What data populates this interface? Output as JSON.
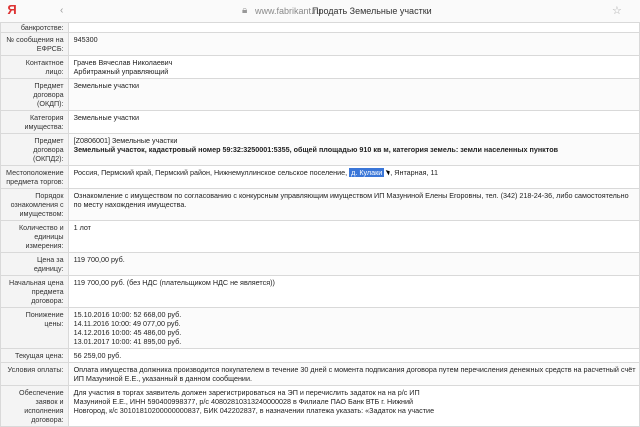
{
  "browser": {
    "yandex_glyph": "Я",
    "host": "www.fabrikant.ru",
    "title": "Продать Земельные участки",
    "nav_icon": "back-icon",
    "lock_icon": "lock-icon",
    "star_icon": "star-icon"
  },
  "rows": [
    {
      "label": "банкротстве:",
      "value": ""
    },
    {
      "label": "№ сообщения на ЕФРСБ:",
      "value": "945300"
    },
    {
      "label": "Контактное лицо:",
      "lines": [
        "Грачев Вячеслав Николаевич",
        "Арбитражный управляющий"
      ]
    },
    {
      "label": "Предмет договора (ОКДП):",
      "value": "Земельные участки"
    },
    {
      "label": "Категория имущества:",
      "value": "Земельные участки"
    },
    {
      "label": "Предмет договора (ОКПД2):",
      "lines": [
        "[Z0806001] Земельные участки",
        "Земельный участок, кадастровый номер 59:32:3250001:5355, общей площадью 910 кв м, категория земель: земли населенных пунктов"
      ]
    },
    {
      "label": "Местоположение предмета торгов:",
      "value_before": "Россия, Пермский край, Пермский район, Нижнемуллинское сельское поселение, ",
      "value_highlight": "д. Кулаки",
      "value_after": ", Янтарная, 11"
    },
    {
      "label": "Порядок ознакомления с имуществом:",
      "value": "Ознакомление с имуществом по согласованию с конкурсным управляющим имуществом ИП Мазуниной Елены Егоровны, тел. (342) 218-24-36, либо самостоятельно по месту нахождения имущества."
    },
    {
      "label": "Количество и единицы измерения:",
      "value": "1 лот"
    },
    {
      "label": "Цена за единицу:",
      "value": "119 700,00 руб."
    },
    {
      "label": "Начальная цена предмета договора:",
      "value": "119 700,00 руб. (без НДС (плательщиком НДС не является))"
    },
    {
      "label": "Понижение цены:",
      "lines": [
        "15.10.2016 10:00: 52 668,00 руб.",
        "14.11.2016 10:00: 49 077,00 руб.",
        "14.12.2016 10:00: 45 486,00 руб.",
        "13.01.2017 10:00: 41 895,00 руб."
      ]
    },
    {
      "label": "Текущая цена:",
      "value": "56 259,00 руб."
    },
    {
      "label": "Условия оплаты:",
      "value": "Оплата имущества должника производится покупателем в течение 30 дней с момента подписания договора путем перечисления денежных средств на расчетный счёт ИП Мазуниной Е.Е., указанный в данном сообщении."
    },
    {
      "label": "Обеспечение заявок и исполнения договора:",
      "lines": [
        "Для участия в торгах заявитель должен зарегистрироваться на ЭП и перечислить задаток на на р/с ИП",
        "Мазуниной Е.Е., ИНН 590400998377, р/с 40802810313240000028 в Филиале ПАО Банк ВТБ г. Нижний",
        "Новгород, к/с 30101810200000000837, БИК 042202837, в назначении платежа указать: «Задаток на участие"
      ]
    }
  ]
}
